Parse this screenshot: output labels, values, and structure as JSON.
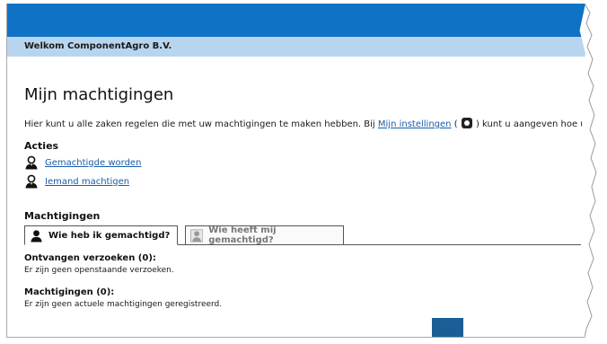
{
  "header": {
    "welcome": "Welkom ComponentAgro B.V."
  },
  "page": {
    "title": "Mijn machtigingen",
    "intro_before": "Hier kunt u alle zaken regelen die met uw machtigingen te maken hebben. Bij ",
    "intro_link": "Mijn instellingen",
    "intro_after": ") kunt u aangeven hoe u bericht"
  },
  "acties": {
    "heading": "Acties",
    "items": [
      {
        "label": "Gemachtigde worden",
        "icon": "person-icon"
      },
      {
        "label": "Iemand machtigen",
        "icon": "person-icon"
      }
    ]
  },
  "machtigingen": {
    "heading": "Machtigingen",
    "tabs": [
      {
        "label": "Wie heb ik gemachtigd?",
        "active": true
      },
      {
        "label": "Wie heeft mij gemachtigd?",
        "active": false
      }
    ],
    "received_heading": "Ontvangen verzoeken (0):",
    "received_text": "Er zijn geen openstaande verzoeken.",
    "current_heading": "Machtigingen (0):",
    "current_text": "Er zijn geen actuele machtigingen geregistreerd."
  },
  "colors": {
    "topbar": "#0f72c5",
    "welcomebar": "#b8d5ef",
    "link": "#1a5da8"
  }
}
